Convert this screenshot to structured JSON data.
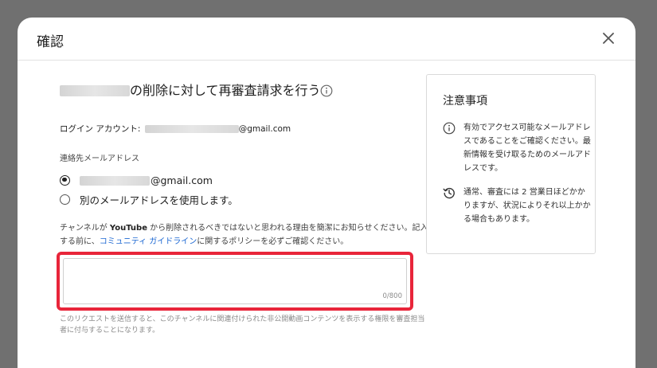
{
  "dialog": {
    "title": "確認"
  },
  "main": {
    "heading": "の削除に対して再審査請求を行う",
    "account_label": "ログイン アカウント:",
    "account_email_suffix": "@gmail.com",
    "contact_email_label": "連絡先メールアドレス",
    "options": [
      {
        "label_suffix": "@gmail.com",
        "checked": true
      },
      {
        "label": "別のメールアドレスを使用します。",
        "checked": false
      }
    ],
    "notice": {
      "part1": "チャンネルが ",
      "brand": "YouTube",
      "part2": " から削除されるべきではないと思われる理由を簡潔にお知らせください。記入する前に、",
      "link": "コミュニティ ガイドライン",
      "part3": "に関するポリシーを必ずご確認ください。"
    },
    "textarea": {
      "value": "",
      "counter": "0/800",
      "highlight_color": "#e8253a"
    },
    "footnote": "このリクエストを送信すると、このチャンネルに関連付けられた非公開動画コンテンツを表示する権限を審査担当者に付与することになります。"
  },
  "side": {
    "title": "注意事項",
    "items": [
      {
        "icon": "info-icon",
        "text": "有効でアクセス可能なメールアドレスであることをご確認ください。最新情報を受け取るためのメールアドレスです。"
      },
      {
        "icon": "history-icon",
        "text": "通常、審査には 2 営業日ほどかかりますが、状況によりそれ以上かかる場合もあります。"
      }
    ]
  },
  "colors": {
    "link": "#1a66d2",
    "highlight": "#e8253a",
    "overlay": "#707070"
  }
}
